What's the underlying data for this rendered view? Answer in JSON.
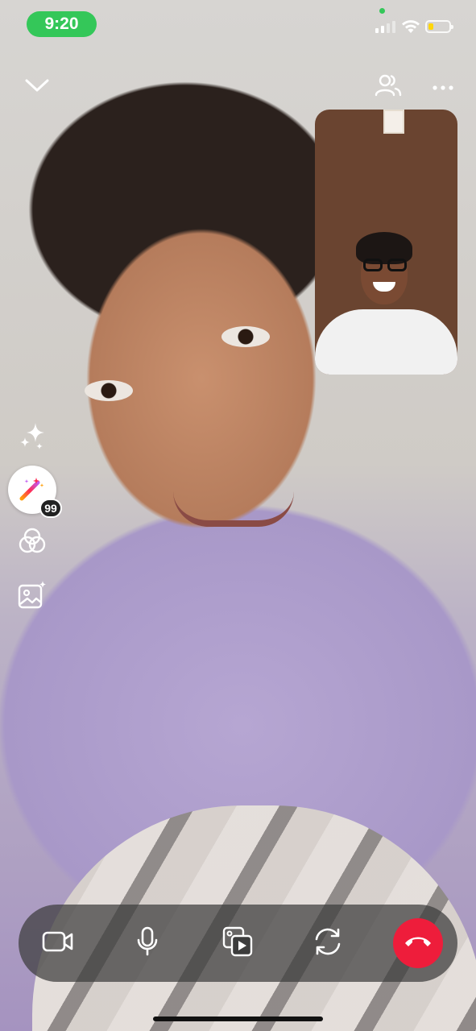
{
  "status_bar": {
    "time": "9:20",
    "battery_level": 0.25,
    "battery_color": "#ffd60a",
    "time_pill_color": "#34c759"
  },
  "top_controls": {
    "collapse_icon": "chevron-down-icon",
    "participants_icon": "people-icon",
    "more_icon": "ellipsis-icon"
  },
  "effects_rail": {
    "sparkles_icon": "sparkles-icon",
    "effects_icon": "magic-wand-icon",
    "effects_badge": "99",
    "filters_icon": "overlapping-circles-icon",
    "backgrounds_icon": "image-sparkle-icon"
  },
  "call_controls": {
    "camera_icon": "video-camera-icon",
    "mic_icon": "microphone-icon",
    "share_icon": "media-share-icon",
    "flip_icon": "camera-flip-icon",
    "end_icon": "end-call-icon",
    "end_color": "#ee1d3b"
  }
}
